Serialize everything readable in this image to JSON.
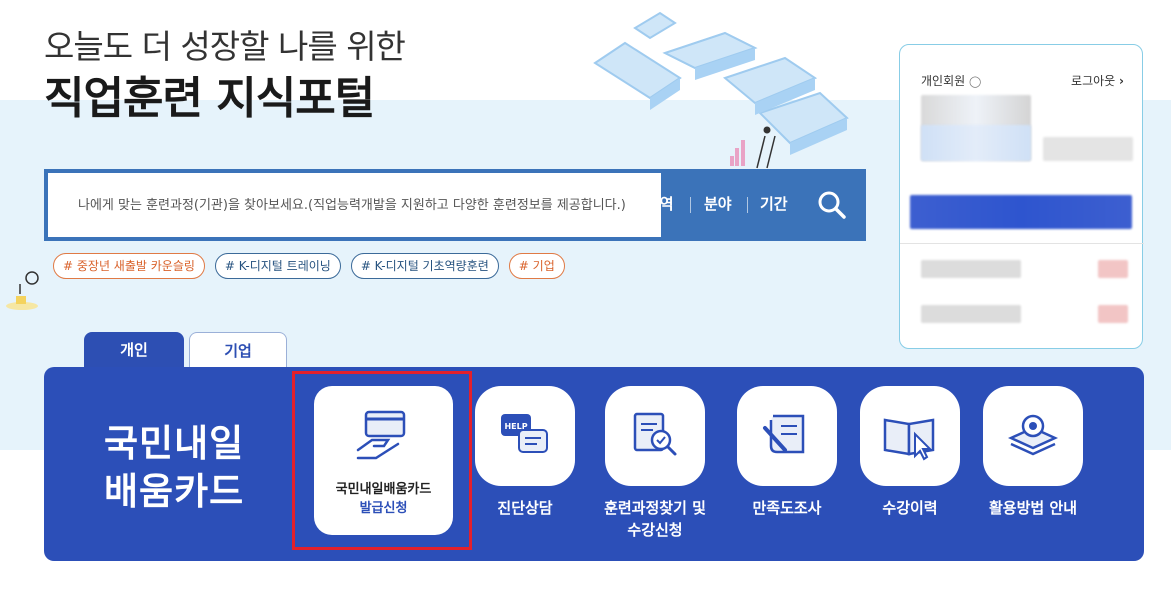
{
  "hero": {
    "subtitle": "오늘도 더 성장할 나를 위한",
    "title": "직업훈련 지식포털"
  },
  "search": {
    "placeholder": "나에게 맞는 훈련과정(기관)을 찾아보세요.(직업능력개발을 지원하고 다양한 훈련정보를 제공합니다.)",
    "filters": [
      "지역",
      "분야",
      "기간"
    ],
    "button_icon": "search-icon"
  },
  "tags": [
    {
      "label": "# 중장년 새출발 카운슬링",
      "color": "#d9622b"
    },
    {
      "label": "# K-디지털 트레이닝",
      "color": "#26527f"
    },
    {
      "label": "# K-디지털 기초역량훈련",
      "color": "#26527f"
    },
    {
      "label": "# 기업",
      "color": "#d9622b"
    }
  ],
  "tabs": [
    {
      "label": "개인",
      "active": true
    },
    {
      "label": "기업",
      "active": false
    }
  ],
  "panel": {
    "title_line1": "국민내일",
    "title_line2": "배움카드",
    "featured": {
      "label_line1": "국민내일배움카드",
      "label_line2": "발급신청",
      "icon": "card-hand-icon"
    },
    "services": [
      {
        "label": "진단상담",
        "icon": "help-chat-icon"
      },
      {
        "label": "훈련과정찾기 및",
        "label2": "수강신청",
        "icon": "document-search-icon"
      },
      {
        "label": "만족도조사",
        "icon": "survey-pen-icon"
      },
      {
        "label": "수강이력",
        "icon": "book-cursor-icon"
      },
      {
        "label": "활용방법 안내",
        "icon": "gear-stack-icon"
      }
    ]
  },
  "login": {
    "member_label": "개인회원",
    "logout_label": "로그아웃"
  },
  "colors": {
    "primary": "#2c4fb8",
    "search_bar": "#3b73b9",
    "highlight": "#e3202b",
    "band": "#e6f3fb"
  }
}
